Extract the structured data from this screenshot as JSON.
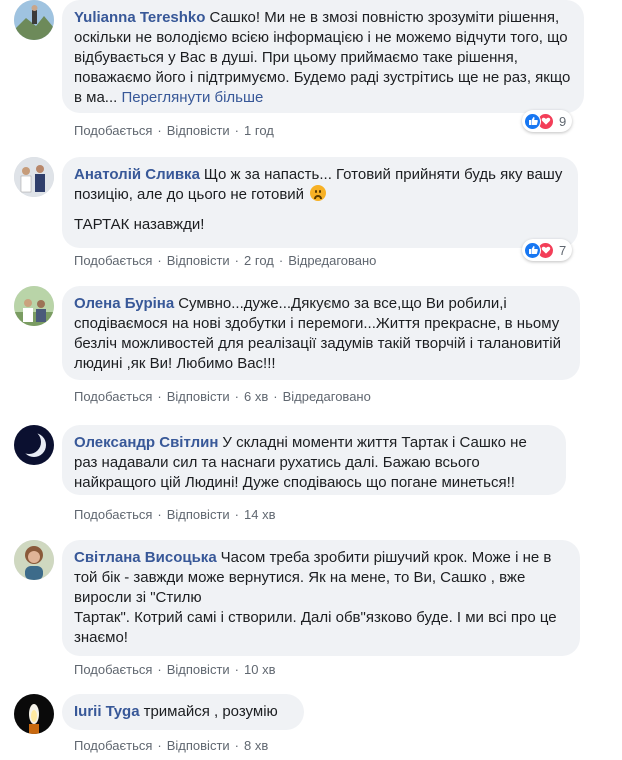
{
  "colors": {
    "author": "#385898",
    "bubble": "#f0f2f5",
    "meta": "#606770",
    "like": "#1877f2",
    "love": "#f33e58"
  },
  "ui": {
    "like": "Подобається",
    "reply": "Відповісти",
    "dot": "·",
    "edited": "Відредаговано"
  },
  "comments": [
    {
      "author": "Yulianna Tereshko",
      "text": "Сашко! Ми не в змозі повністю зрозуміти рішення, оскільки не володіємо всією інформацією і не можемо відчути того, що відбувається у Вас в душі. При цьому приймаємо таке рішення, поважаємо його і підтримуємо. Будемо раді зустрітись ще не раз, якщо в ма...",
      "more": "Переглянути більше",
      "time": "1 год",
      "reactions": "9",
      "reaction_icons": [
        "like-icon",
        "love-icon"
      ]
    },
    {
      "author": "Анатолій Сливка",
      "text": "Що ж за напасть... Готовий прийняти будь яку вашу позицію, але до цього не готовий",
      "emoji": "sad-face-emoji-icon",
      "text2": "ТАРТАК назавжди!",
      "time": "2 год",
      "reactions": "7",
      "reaction_icons": [
        "like-icon",
        "love-icon"
      ]
    },
    {
      "author": "Олена Буріна",
      "text": "Сумвно...дуже...Дякуємо за все,що Ви робили,і сподіваємося на нові здобутки і перемоги...Життя прекрасне, в ньому безліч можливостей для реалізації задумів такій творчій і талановитій людині ,як Ви! Любимо Вас!!!",
      "time": "6 хв"
    },
    {
      "author": "Олександр Світлин",
      "text": "У складні моменти життя Тартак і Сашко не раз надавали сил та наснаги рухатись далі. Бажаю всього найкращого цій Людині! Дуже сподіваюсь що погане минеться!!",
      "time": "14 хв"
    },
    {
      "author": "Світлана Висоцька",
      "text": "Часом треба зробити рішучий крок. Може і не в той бік - завжди може вернутися. Як на мене, то Ви, Сашко , вже виросли зі \"Стилю\nТартак\". Котрий самі і створили. Далі обв\"язково буде. І ми всі про це знаємо!",
      "time": "10 хв"
    },
    {
      "author": "Iurii Tyga",
      "text": "тримайся , розумію",
      "time": "8 хв"
    }
  ]
}
